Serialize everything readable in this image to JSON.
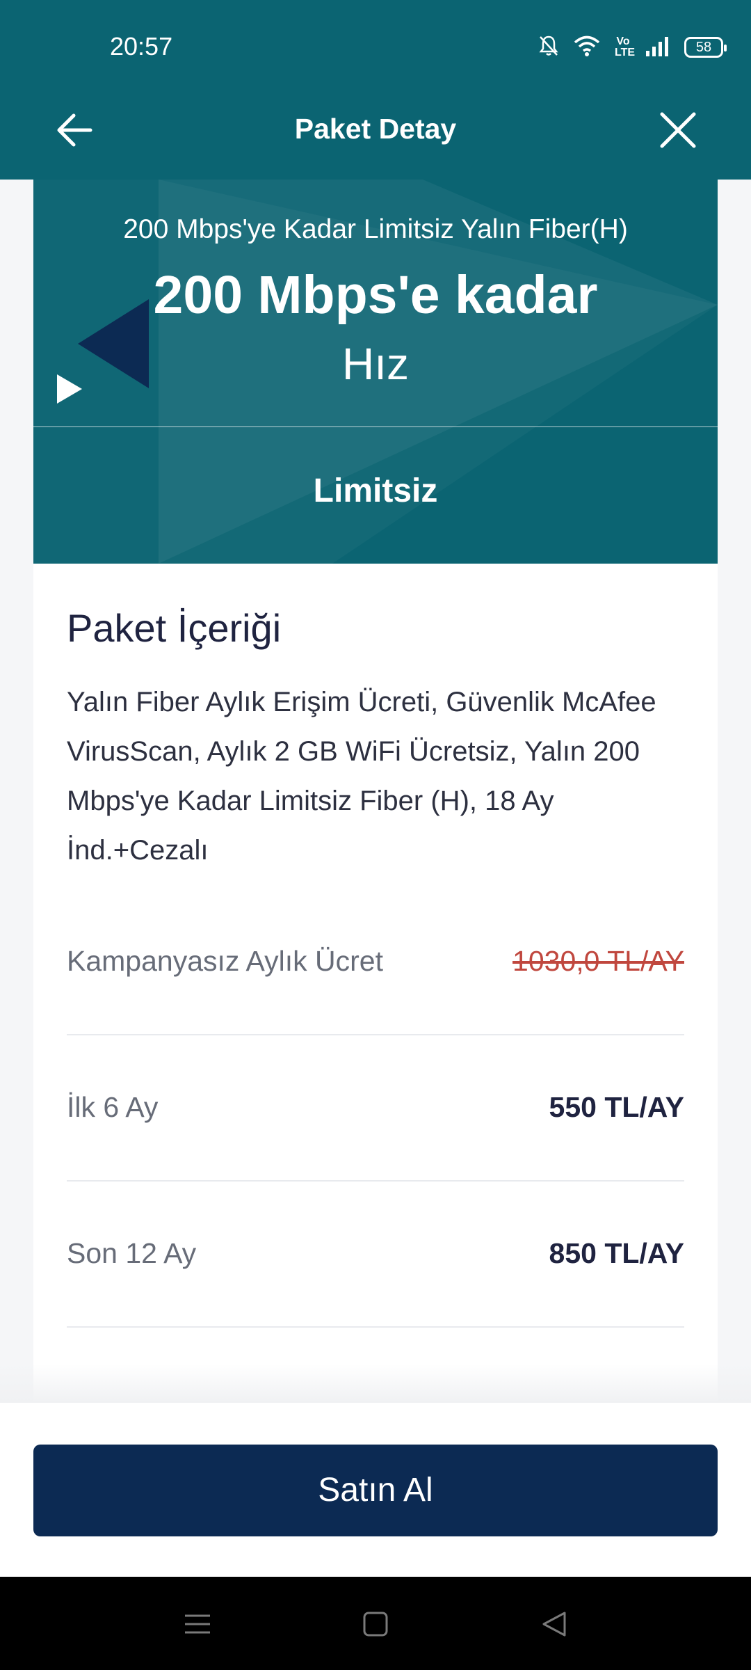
{
  "status_bar": {
    "time": "20:57",
    "volte": "Vo LTE",
    "battery": "58"
  },
  "header": {
    "title": "Paket Detay",
    "back_icon": "arrow-left-icon",
    "close_icon": "close-icon"
  },
  "hero": {
    "subtitle": "200 Mbps'ye Kadar Limitsiz Yalın Fiber(H)",
    "speed": "200 Mbps'e kadar",
    "unit": "Hız",
    "limit": "Limitsiz",
    "play_icon": "play-icon"
  },
  "package": {
    "title": "Paket İçeriği",
    "description": "Yalın Fiber Aylık Erişim Ücreti, Güvenlik McAfee VirusScan, Aylık 2 GB WiFi Ücretsiz, Yalın 200 Mbps'ye Kadar Limitsiz Fiber (H), 18 Ay İnd.+Cezalı"
  },
  "prices": [
    {
      "label": "Kampanyasız Aylık Ücret",
      "value": "1030,0 TL/AY",
      "struck": true
    },
    {
      "label": "İlk 6 Ay",
      "value": "550 TL/AY",
      "struck": false
    },
    {
      "label": "Son 12 Ay",
      "value": "850 TL/AY",
      "struck": false
    }
  ],
  "actions": {
    "buy_label": "Satın Al"
  },
  "colors": {
    "header_bg": "#0b6472",
    "button_bg": "#0c2a53",
    "strike_price": "#c0473e"
  },
  "nav": {
    "menu_icon": "menu-icon",
    "home_icon": "home-icon",
    "back_icon": "back-triangle-icon"
  }
}
